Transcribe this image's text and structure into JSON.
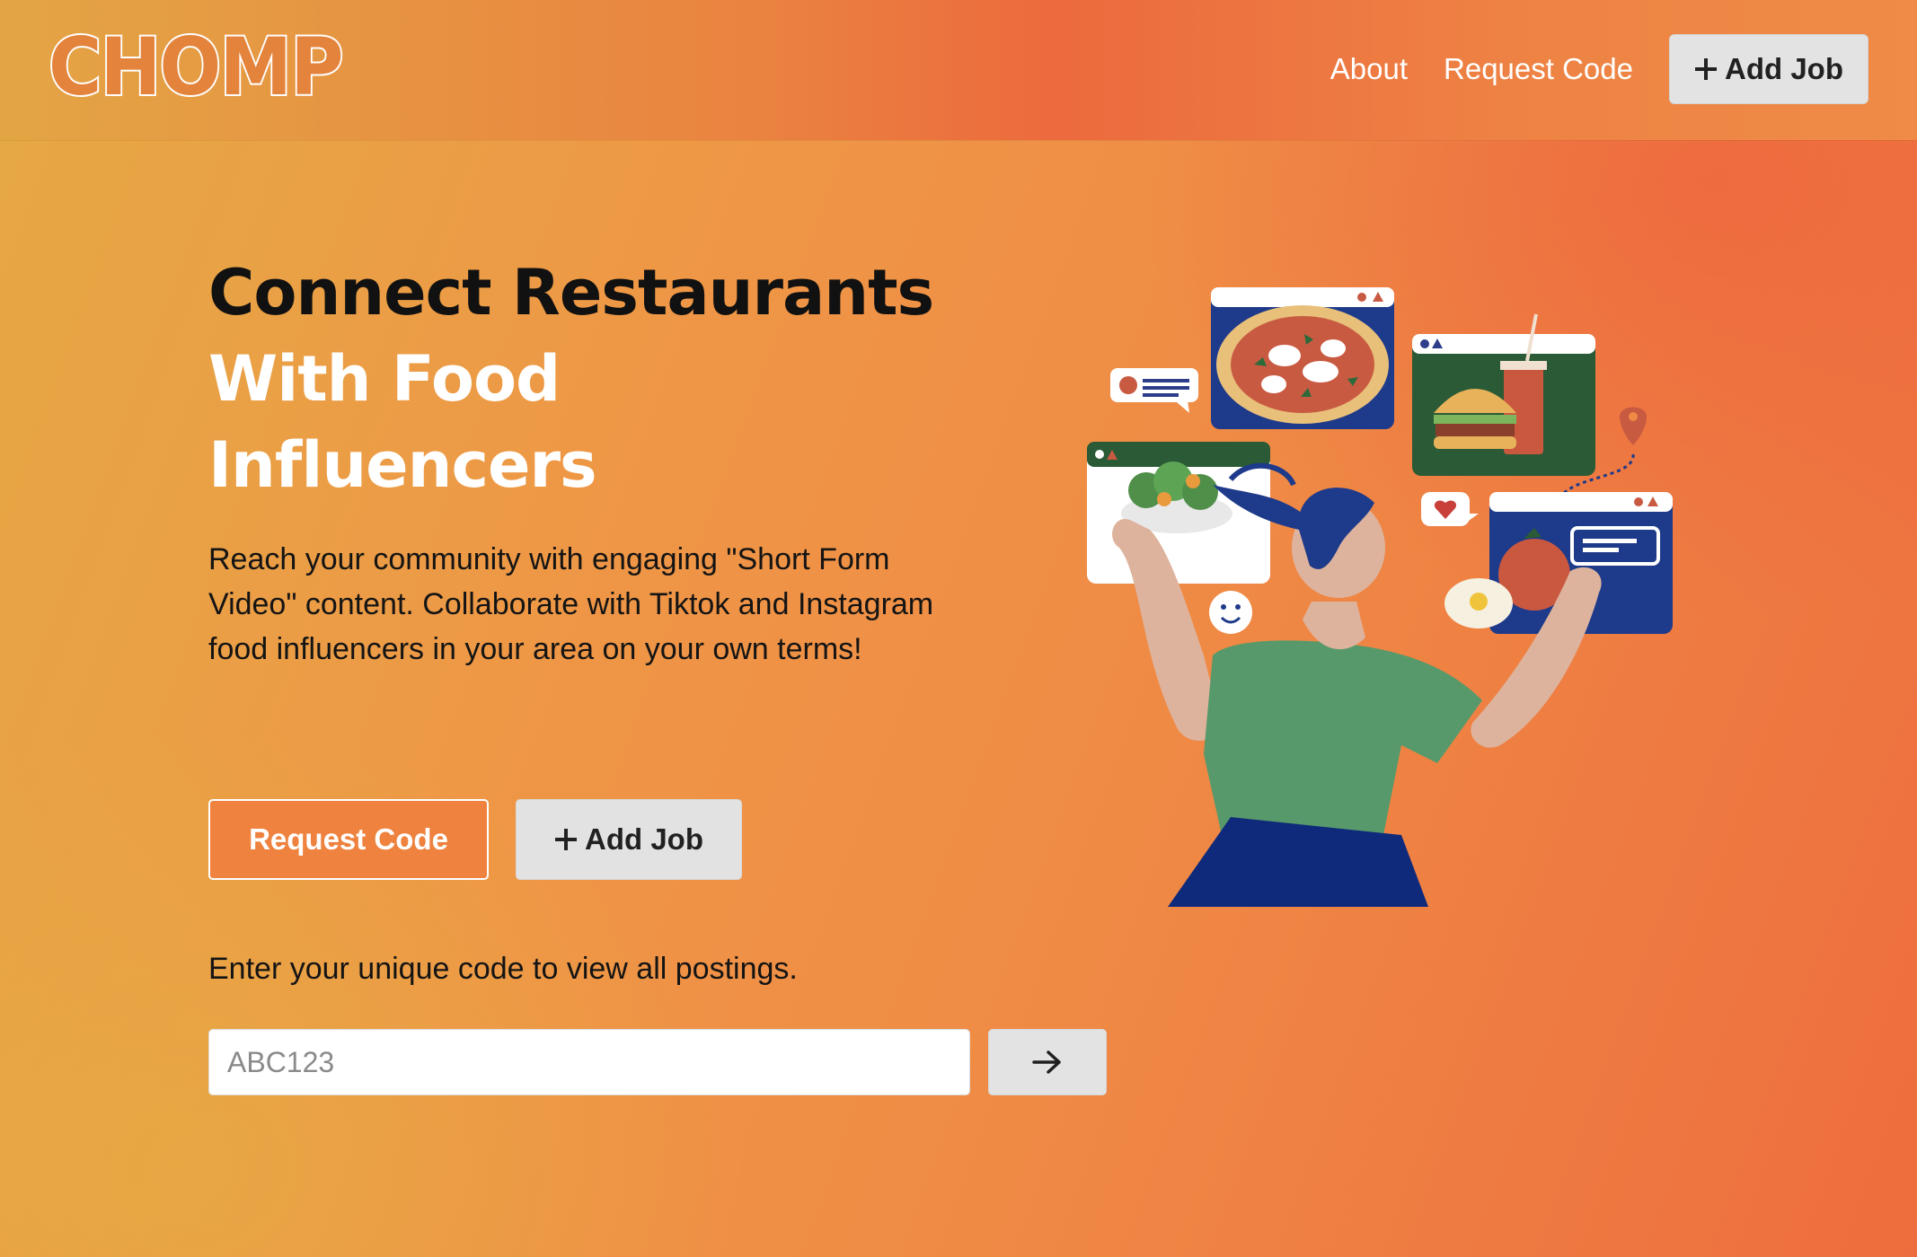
{
  "header": {
    "logo": "CHOMP",
    "nav": {
      "about": "About",
      "request_code": "Request Code",
      "add_job": "Add Job"
    }
  },
  "hero": {
    "title_line1": "Connect Restaurants",
    "title_line2": "With Food",
    "title_line3": "Influencers",
    "description": "Reach your community with engaging \"Short Form Video\" content. Collaborate with Tiktok and Instagram food influencers in your area on your own terms!",
    "request_code_label": "Request Code",
    "add_job_label": "Add Job"
  },
  "code_entry": {
    "prompt": "Enter your unique code to view all postings.",
    "placeholder": "ABC123",
    "value": "",
    "submit_icon": "arrow-right-icon"
  },
  "icons": {
    "plus": "plus-icon",
    "arrow": "arrow-right-icon"
  },
  "colors": {
    "accent": "#ee823e",
    "button_gray": "#e3e3e3",
    "text_dark": "#111111"
  }
}
